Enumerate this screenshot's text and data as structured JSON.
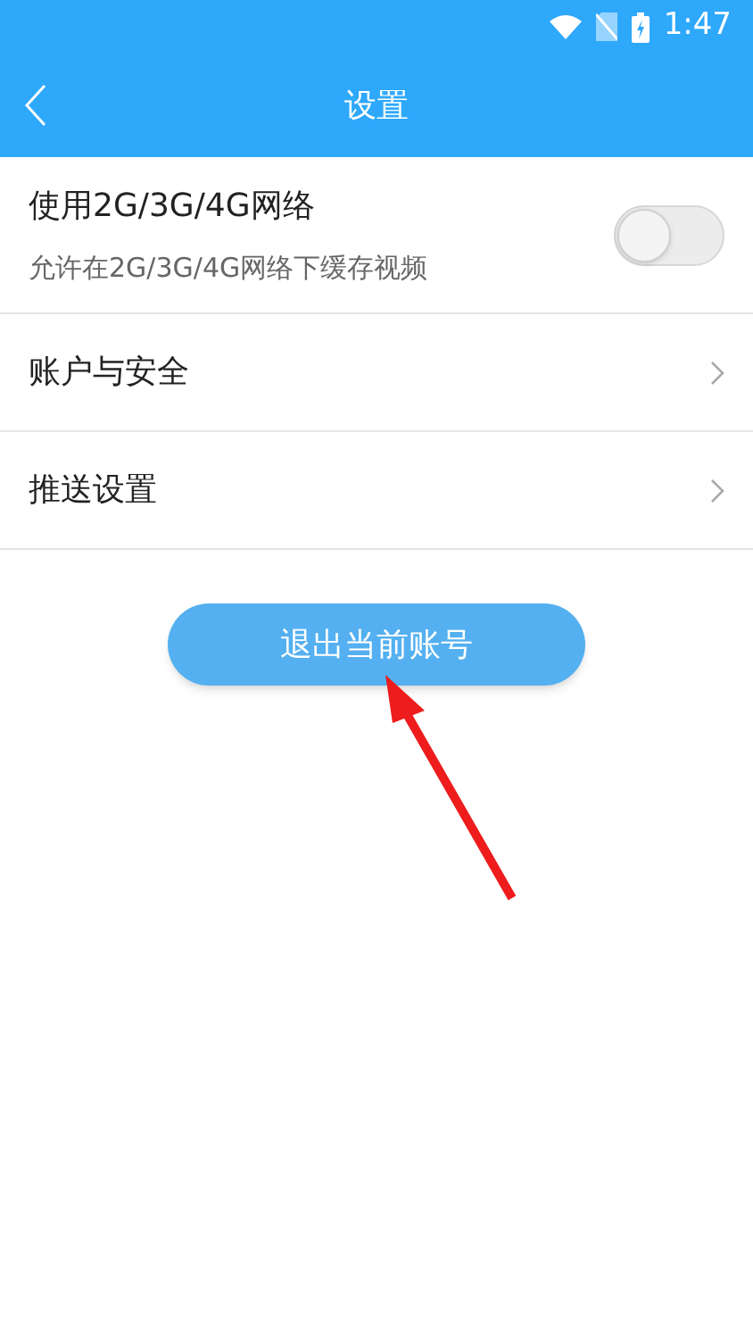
{
  "status_bar": {
    "time": "1:47"
  },
  "header": {
    "title": "设置"
  },
  "settings": [
    {
      "kind": "toggle",
      "label": "使用2G/3G/4G网络",
      "description": "允许在2G/3G/4G网络下缓存视频",
      "on": false
    },
    {
      "kind": "link",
      "label": "账户与安全"
    },
    {
      "kind": "link",
      "label": "推送设置"
    }
  ],
  "logout_button": {
    "label": "退出当前账号"
  }
}
